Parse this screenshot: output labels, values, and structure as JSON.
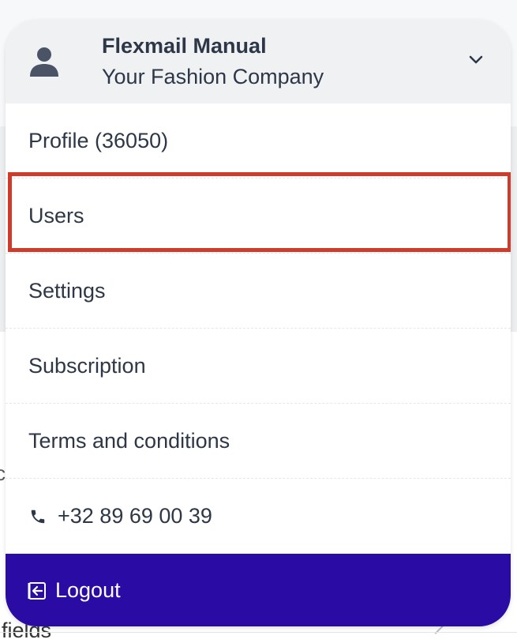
{
  "account": {
    "name": "Flexmail Manual",
    "company": "Your Fashion Company",
    "avatar_icon": "user-icon",
    "toggle_icon": "chevron-down-icon"
  },
  "menu": {
    "items": [
      {
        "label": "Profile (36050)"
      },
      {
        "label": "Users",
        "highlighted": true
      },
      {
        "label": "Settings"
      },
      {
        "label": "Subscription"
      },
      {
        "label": "Terms and conditions"
      }
    ],
    "phone": {
      "icon": "phone-icon",
      "label": "+32 89 69 00 39"
    },
    "logout": {
      "icon": "logout-icon",
      "label": "Logout"
    }
  },
  "background": {
    "partial_letter": "c",
    "partial_text": "fields"
  },
  "colors": {
    "header_background": "#f0f1f3",
    "logout_background": "#2a0ba3",
    "highlight_border": "#d03a2b",
    "text": "#2d3748"
  }
}
